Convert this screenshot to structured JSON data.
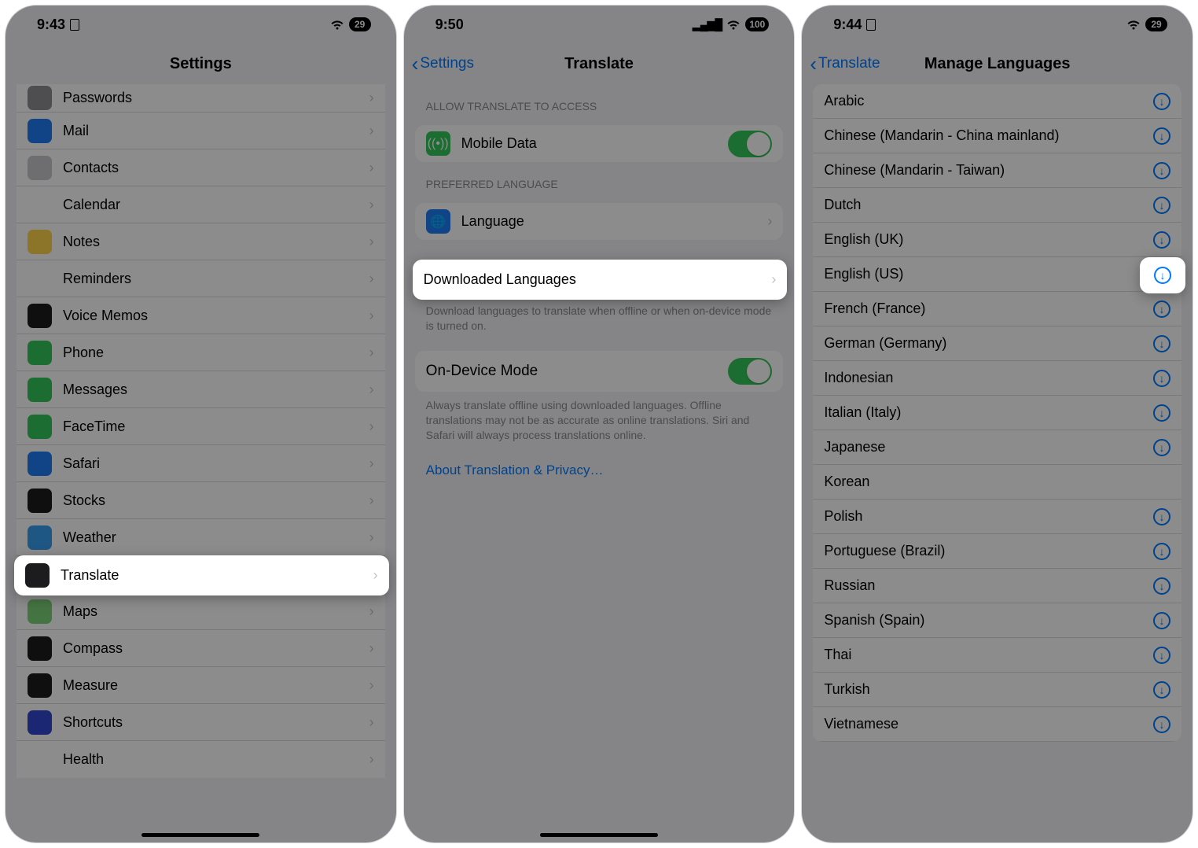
{
  "screen1": {
    "status": {
      "time": "9:43",
      "battery": "29"
    },
    "title": "Settings",
    "items": [
      {
        "label": "Passwords",
        "icon_bg": "#8e8e93"
      },
      {
        "label": "Mail",
        "icon_bg": "#1f7cf6"
      },
      {
        "label": "Contacts",
        "icon_bg": "#c9c9cd"
      },
      {
        "label": "Calendar",
        "icon_bg": "#ffffff"
      },
      {
        "label": "Notes",
        "icon_bg": "#ffd54a"
      },
      {
        "label": "Reminders",
        "icon_bg": "#ffffff"
      },
      {
        "label": "Voice Memos",
        "icon_bg": "#1c1c1e"
      },
      {
        "label": "Phone",
        "icon_bg": "#34c759"
      },
      {
        "label": "Messages",
        "icon_bg": "#34c759"
      },
      {
        "label": "FaceTime",
        "icon_bg": "#34c759"
      },
      {
        "label": "Safari",
        "icon_bg": "#1f7cf6"
      },
      {
        "label": "Stocks",
        "icon_bg": "#1c1c1e"
      },
      {
        "label": "Weather",
        "icon_bg": "#3a9ff0"
      },
      {
        "label": "Translate",
        "icon_bg": "#1c1c1e"
      },
      {
        "label": "Maps",
        "icon_bg": "#7fd37a"
      },
      {
        "label": "Compass",
        "icon_bg": "#1c1c1e"
      },
      {
        "label": "Measure",
        "icon_bg": "#1c1c1e"
      },
      {
        "label": "Shortcuts",
        "icon_bg": "#3347d1"
      },
      {
        "label": "Health",
        "icon_bg": "#ffffff"
      }
    ],
    "highlight_index": 13
  },
  "screen2": {
    "status": {
      "time": "9:50",
      "battery": "100"
    },
    "back": "Settings",
    "title": "Translate",
    "section1_header": "ALLOW TRANSLATE TO ACCESS",
    "mobile_data": "Mobile Data",
    "section2_header": "PREFERRED LANGUAGE",
    "language": "Language",
    "downloaded": "Downloaded Languages",
    "dl_footer": "Download languages to translate when offline or when on-device mode is turned on.",
    "ondevice": "On-Device Mode",
    "ondevice_footer": "Always translate offline using downloaded languages. Offline translations may not be as accurate as online translations. Siri and Safari will always process translations online.",
    "about_link": "About Translation & Privacy…"
  },
  "screen3": {
    "status": {
      "time": "9:44",
      "battery": "29"
    },
    "back": "Translate",
    "title": "Manage Languages",
    "languages": [
      {
        "label": "Arabic",
        "state": "download"
      },
      {
        "label": "Chinese (Mandarin - China mainland)",
        "state": "download"
      },
      {
        "label": "Chinese (Mandarin - Taiwan)",
        "state": "download"
      },
      {
        "label": "Dutch",
        "state": "download"
      },
      {
        "label": "English (UK)",
        "state": "download"
      },
      {
        "label": "English (US)",
        "state": "download"
      },
      {
        "label": "French (France)",
        "state": "download"
      },
      {
        "label": "German (Germany)",
        "state": "download"
      },
      {
        "label": "Indonesian",
        "state": "download"
      },
      {
        "label": "Italian (Italy)",
        "state": "download"
      },
      {
        "label": "Japanese",
        "state": "download"
      },
      {
        "label": "Korean",
        "state": "downloading"
      },
      {
        "label": "Polish",
        "state": "download"
      },
      {
        "label": "Portuguese (Brazil)",
        "state": "download"
      },
      {
        "label": "Russian",
        "state": "download"
      },
      {
        "label": "Spanish (Spain)",
        "state": "download"
      },
      {
        "label": "Thai",
        "state": "download"
      },
      {
        "label": "Turkish",
        "state": "download"
      },
      {
        "label": "Vietnamese",
        "state": "download"
      }
    ],
    "highlight_index": 5
  }
}
